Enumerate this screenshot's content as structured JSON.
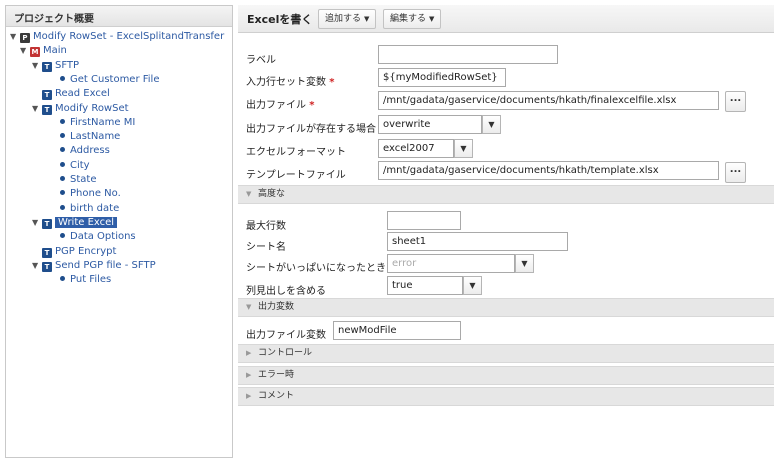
{
  "tree": {
    "header": "プロジェクト概要",
    "nodes": [
      {
        "label": "Modify RowSet - ExcelSplitandTransfer",
        "icon": "P",
        "icon_name": "project-icon",
        "expanded": true,
        "level": 0
      },
      {
        "label": "Main",
        "icon": "M",
        "icon_name": "main-flow-icon",
        "expanded": true,
        "level": 1
      },
      {
        "label": "SFTP",
        "icon": "T",
        "icon_name": "task-icon",
        "expanded": true,
        "level": 2
      },
      {
        "label": "Get Customer File",
        "icon": "bullet",
        "icon_name": "bullet-icon",
        "level": 3
      },
      {
        "label": "Read Excel",
        "icon": "T",
        "icon_name": "task-icon",
        "level": 2
      },
      {
        "label": "Modify RowSet",
        "icon": "T",
        "icon_name": "task-icon",
        "expanded": true,
        "level": 2
      },
      {
        "label": "FirstName MI",
        "icon": "bullet",
        "icon_name": "bullet-icon",
        "level": 3
      },
      {
        "label": "LastName",
        "icon": "bullet",
        "icon_name": "bullet-icon",
        "level": 3
      },
      {
        "label": "Address",
        "icon": "bullet",
        "icon_name": "bullet-icon",
        "level": 3
      },
      {
        "label": "City",
        "icon": "bullet",
        "icon_name": "bullet-icon",
        "level": 3
      },
      {
        "label": "State",
        "icon": "bullet",
        "icon_name": "bullet-icon",
        "level": 3
      },
      {
        "label": "Phone No.",
        "icon": "bullet",
        "icon_name": "bullet-icon",
        "level": 3
      },
      {
        "label": "birth date",
        "icon": "bullet",
        "icon_name": "bullet-icon",
        "level": 3
      },
      {
        "label": "Write Excel",
        "icon": "T",
        "icon_name": "task-icon",
        "expanded": true,
        "level": 2,
        "selected": true
      },
      {
        "label": "Data Options",
        "icon": "bullet",
        "icon_name": "bullet-icon",
        "level": 3
      },
      {
        "label": "PGP Encrypt",
        "icon": "T",
        "icon_name": "task-icon",
        "level": 2
      },
      {
        "label": "Send PGP file - SFTP",
        "icon": "T",
        "icon_name": "task-icon",
        "expanded": true,
        "level": 2
      },
      {
        "label": "Put Files",
        "icon": "bullet",
        "icon_name": "bullet-icon",
        "level": 3
      }
    ]
  },
  "toolbar": {
    "title": "Excelを書く",
    "add_label": "追加する",
    "edit_label": "編集する"
  },
  "form": {
    "label_label": "ラベル",
    "label_value": "",
    "input_rowset_label": "入力行セット変数",
    "input_rowset_value": "${myModifiedRowSet}",
    "output_file_label": "出力ファイル",
    "output_file_value": "/mnt/gadata/gaservice/documents/hkath/finalexcelfile.xlsx",
    "if_exists_label": "出力ファイルが存在する場合",
    "if_exists_value": "overwrite",
    "excel_format_label": "エクセルフォーマット",
    "excel_format_value": "excel2007",
    "template_label": "テンプレートファイル",
    "template_value": "/mnt/gadata/gaservice/documents/hkath/template.xlsx",
    "required_mark": "*",
    "ellipsis": "..."
  },
  "advanced": {
    "header": "高度な",
    "max_rows_label": "最大行数",
    "max_rows_value": "",
    "sheet_name_label": "シート名",
    "sheet_name_value": "sheet1",
    "sheet_full_label": "シートがいっぱいになったとき",
    "sheet_full_placeholder": "error",
    "include_headers_label": "列見出しを含める",
    "include_headers_value": "true"
  },
  "output_vars": {
    "header": "出力変数",
    "output_file_var_label": "出力ファイル変数",
    "output_file_var_value": "newModFile"
  },
  "collapsed_sections": {
    "control": "コントロール",
    "on_error": "エラー時",
    "comment": "コメント"
  },
  "glyphs": {
    "expanded": "▼",
    "collapsed": "▶",
    "dropdown": "▼"
  },
  "colors": {
    "selected_bg": "#2f5ea8",
    "link_text": "#2d5aa3",
    "required": "#d02424"
  }
}
